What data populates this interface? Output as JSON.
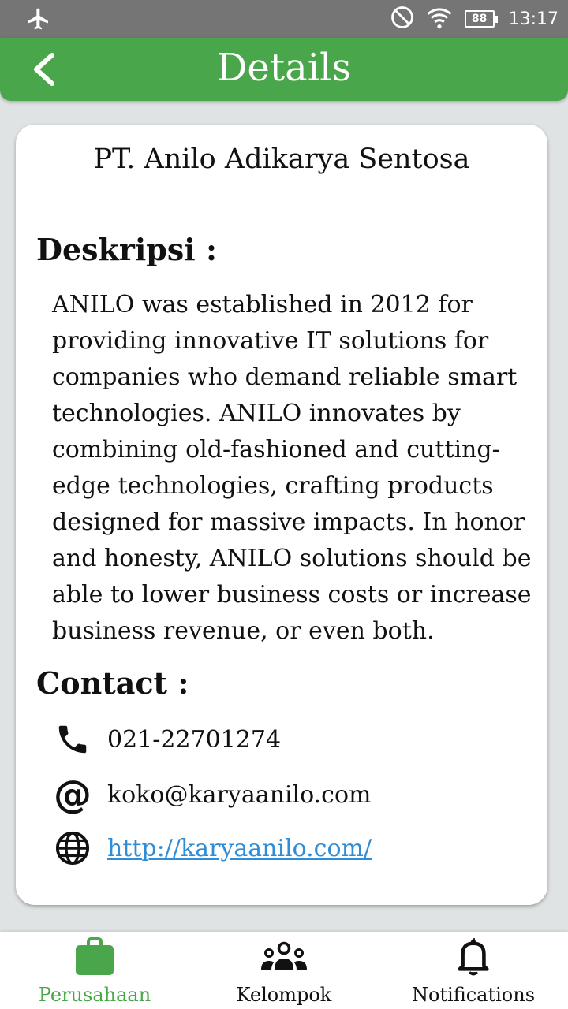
{
  "status_bar": {
    "battery": "88",
    "time": "13:17"
  },
  "header": {
    "title": "Details"
  },
  "company": {
    "name": "PT. Anilo Adikarya Sentosa"
  },
  "description": {
    "label": "Deskripsi :",
    "text": "ANILO was established in 2012 for providing innovative IT solutions for companies who demand reliable smart technologies. ANILO innovates by combining old-fashioned and cutting-edge technologies, crafting products designed for massive impacts. In honor and honesty, ANILO solutions should be able to lower business costs or increase business revenue, or even both."
  },
  "contact": {
    "label": "Contact :",
    "phone": "021-22701274",
    "email": "koko@karyaanilo.com",
    "website": "http://karyaanilo.com/"
  },
  "bottom_nav": {
    "items": [
      {
        "label": "Perusahaan",
        "icon": "briefcase-icon",
        "active": true
      },
      {
        "label": "Kelompok",
        "icon": "group-icon",
        "active": false
      },
      {
        "label": "Notifications",
        "icon": "bell-icon",
        "active": false
      }
    ]
  },
  "colors": {
    "primary": "#4aa64a",
    "status_bar": "#757575",
    "link": "#2f8dd7",
    "background": "#dfe3e4"
  }
}
